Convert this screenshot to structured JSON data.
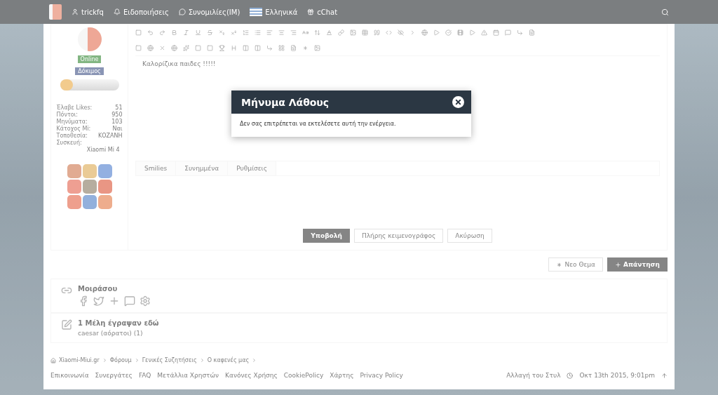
{
  "top_bar": {
    "items": [
      {
        "kind": "user",
        "label": "trickfq"
      },
      {
        "kind": "bell",
        "label": "Ειδοποιήσεις"
      },
      {
        "kind": "chat",
        "label": "Συνομιλίες(IM)"
      },
      {
        "kind": "flag",
        "label": "Ελληνικά"
      },
      {
        "kind": "gift",
        "label": "cChat"
      }
    ]
  },
  "profile": {
    "status": "Online",
    "rank": "Δόκιμος",
    "stats": [
      {
        "label": "Έλαβε Likes:",
        "value": "51"
      },
      {
        "label": "Πόντοι:",
        "value": "950"
      },
      {
        "label": "Μηνύματα:",
        "value": "103"
      },
      {
        "label": "Κάτοχος Mi:",
        "value": "Ναι"
      },
      {
        "label": "Τοποθεσία:",
        "value": "ΚΟΖΑΝΗ"
      },
      {
        "label": "Συσκευή:"
      }
    ],
    "device": "Xiaomi Mi 4"
  },
  "editor": {
    "text": "Καλορίζικα παιδες !!!!!",
    "tabs": [
      "Smilies",
      "Συνημμένα",
      "Ρυθμίσεις"
    ],
    "buttons": [
      {
        "label": "Υποβολή",
        "kind": "primary"
      },
      {
        "label": "Πλήρης κειμενογράφος",
        "kind": "plain"
      },
      {
        "label": "Ακύρωση",
        "kind": "plain"
      }
    ]
  },
  "thread_buttons": [
    {
      "label": "Νεο Θεμα",
      "kind": "plain"
    },
    {
      "label": "Απάντηση",
      "kind": "primary"
    }
  ],
  "share": {
    "title": "Μοιράσου"
  },
  "online": {
    "title": "1 Μέλη έγραψαν εδώ",
    "members": "caesar (αόρατοι) (1)"
  },
  "breadcrumb": [
    "Xiaomi-Miui.gr",
    "Φόρουμ",
    "Γενικές Συζητήσεις",
    "Ο καφενές μας"
  ],
  "footer": {
    "links": [
      "Επικοινωνία",
      "Συνεργάτες",
      "FAQ",
      "Μετάλλια Χρηστών",
      "Κανόνες Χρήσης",
      "CookiePolicy",
      "Χάρτης",
      "Privacy Policy"
    ],
    "style_link": "Αλλαγή του Στυλ",
    "time": "Οκτ 13th 2015, 9:01pm"
  },
  "dialog": {
    "title": "Μήνυμα Λάθους",
    "message": "Δεν σας επιτρέπεται να εκτελέσετε αυτή την ενέργεια."
  }
}
